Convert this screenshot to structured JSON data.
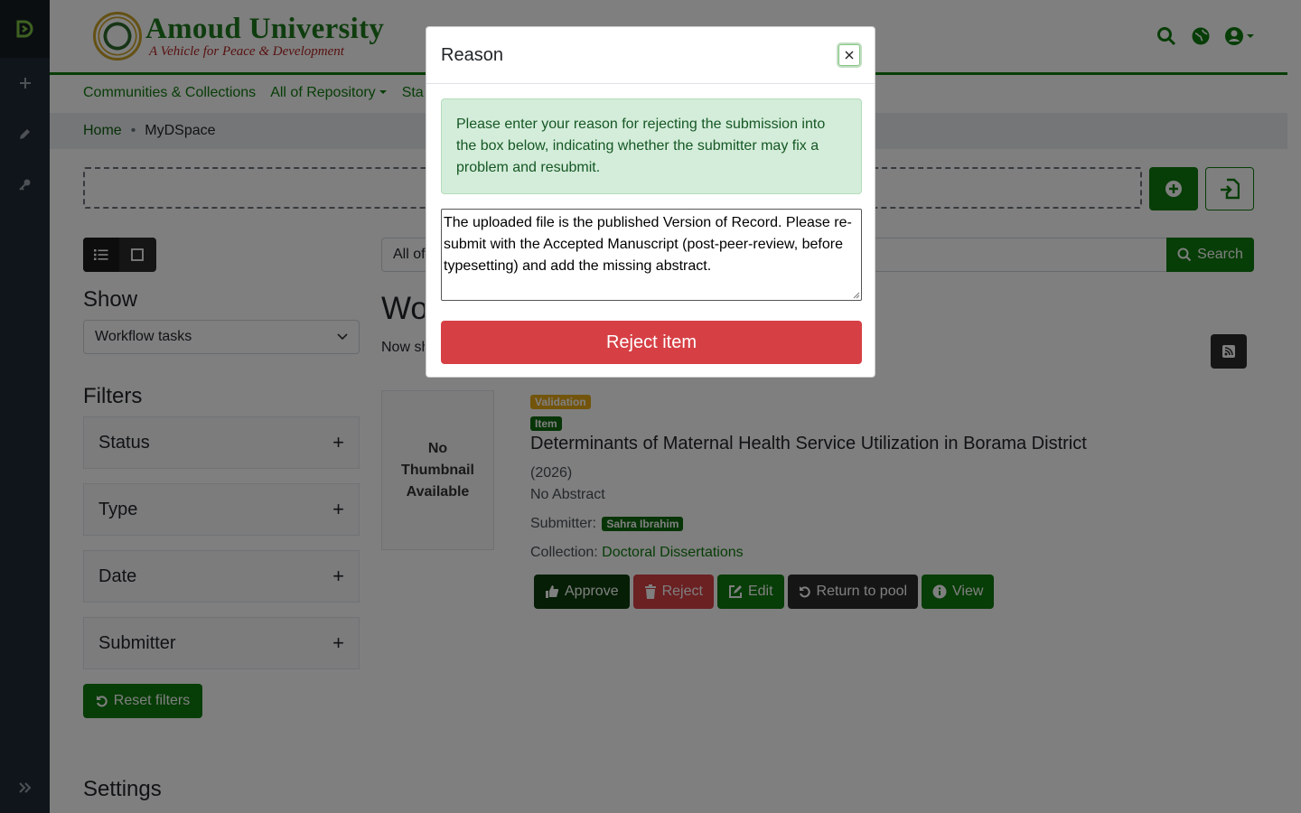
{
  "admin_sidebar": {
    "icons": [
      "dspace-logo-icon",
      "plus-icon",
      "pencil-icon",
      "key-icon",
      "expand-icon"
    ]
  },
  "header": {
    "logo_title": "Amoud University",
    "logo_motto": "A Vehicle for Peace & Development",
    "icons": [
      "search-icon",
      "globe-icon",
      "user-icon"
    ]
  },
  "nav": {
    "items": [
      "Communities & Collections",
      "All of Repository",
      "Sta"
    ]
  },
  "breadcrumb": {
    "home": "Home",
    "separator": "•",
    "current": "MyDSpace"
  },
  "colors": {
    "brand_green": "#0e7a0e",
    "danger": "#d64045",
    "warning": "#e6a817",
    "dark": "#2b2b2b"
  },
  "sidebar": {
    "show_heading": "Show",
    "show_select_value": "Workflow tasks",
    "filters_heading": "Filters",
    "filters": [
      "Status",
      "Type",
      "Date",
      "Submitter"
    ],
    "reset_label": "Reset filters",
    "settings_heading": "Settings"
  },
  "search": {
    "scope_label": "All of",
    "button_label": "Search"
  },
  "results": {
    "title": "Wo",
    "subtitle": "Now sh"
  },
  "item": {
    "thumbnail_text": "No Thumbnail Available",
    "badge_status": "Validation",
    "badge_type": "Item",
    "title": "Determinants of Maternal Health Service Utilization in Borama District",
    "date": "(2026)",
    "abstract": "No Abstract",
    "submitter_label": "Submitter:",
    "submitter_name": "Sahra Ibrahim",
    "collection_label": "Collection:",
    "collection_name": "Doctoral Dissertations",
    "actions": {
      "approve": "Approve",
      "reject": "Reject",
      "edit": "Edit",
      "return": "Return to pool",
      "view": "View"
    }
  },
  "modal": {
    "title": "Reason",
    "info": "Please enter your reason for rejecting the submission into the box below, indicating whether the submitter may fix a problem and resubmit.",
    "reason_value": "The uploaded file is the published Version of Record. Please re-submit with the Accepted Manuscript (post-peer-review, before typesetting) and add the missing abstract.",
    "submit_label": "Reject item"
  }
}
